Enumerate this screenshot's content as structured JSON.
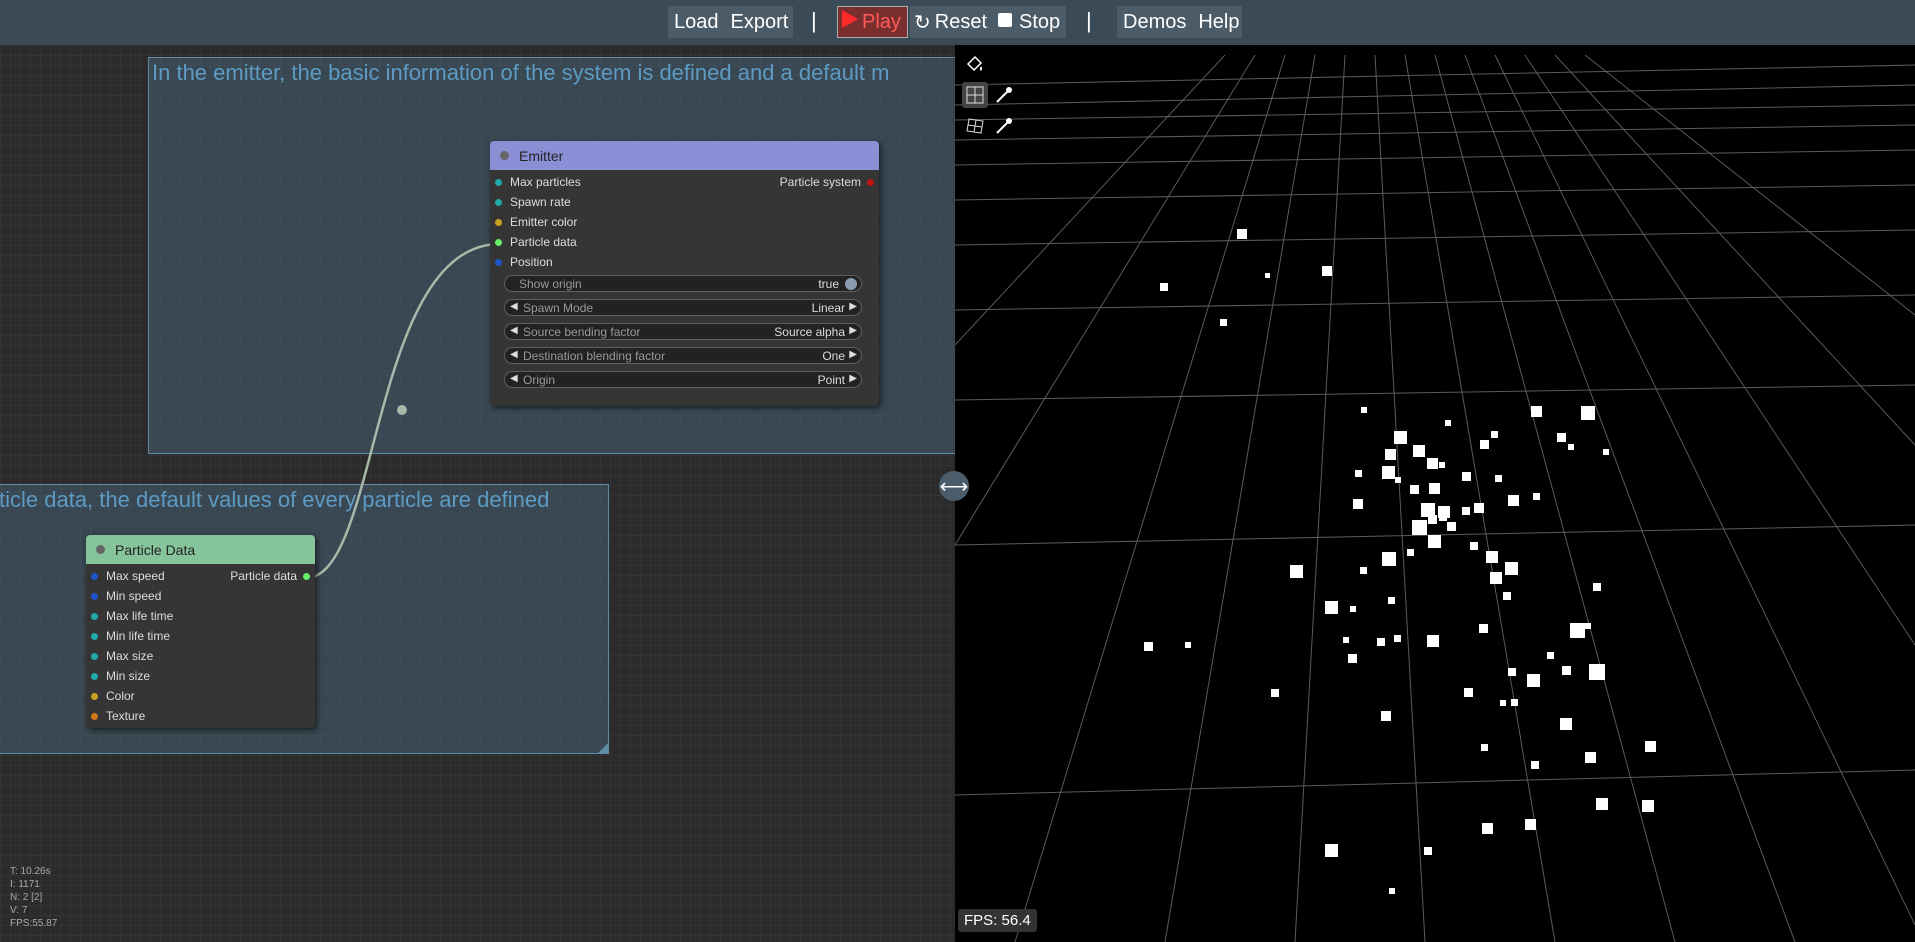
{
  "toolbar": {
    "load": "Load",
    "export": "Export",
    "sep1": "|",
    "play": "Play",
    "reset": "Reset",
    "stop": "Stop",
    "sep2": "|",
    "demos": "Demos",
    "help": "Help"
  },
  "groups": {
    "emitter_note": "In the emitter, the basic information of the system is defined and a default m",
    "particle_note": "ticle data, the default values of every particle are defined"
  },
  "emitter_node": {
    "title": "Emitter",
    "inputs": [
      "Max particles",
      "Spawn rate",
      "Emitter color",
      "Particle data",
      "Position"
    ],
    "output": "Particle system",
    "widgets": {
      "show_origin": {
        "label": "Show origin",
        "value": "true"
      },
      "spawn_mode": {
        "label": "Spawn Mode",
        "value": "Linear"
      },
      "source_bending": {
        "label": "Source bending factor",
        "value": "Source alpha"
      },
      "dest_blending": {
        "label": "Destination blending factor",
        "value": "One"
      },
      "origin": {
        "label": "Origin",
        "value": "Point"
      }
    }
  },
  "particle_node": {
    "title": "Particle Data",
    "inputs": [
      "Max speed",
      "Min speed",
      "Max life time",
      "Min life time",
      "Max size",
      "Min size",
      "Color",
      "Texture"
    ],
    "output": "Particle data"
  },
  "stats": [
    "T: 10.26s",
    "I: 1171",
    "N: 2 [2]",
    "V: 7",
    "FPS:55.87"
  ],
  "viewport": {
    "fps": "FPS: 56.4"
  },
  "colors": {
    "emitter_header": "#8a8fd6",
    "particle_header": "#86c59c",
    "accent_play": "#ff3333"
  }
}
